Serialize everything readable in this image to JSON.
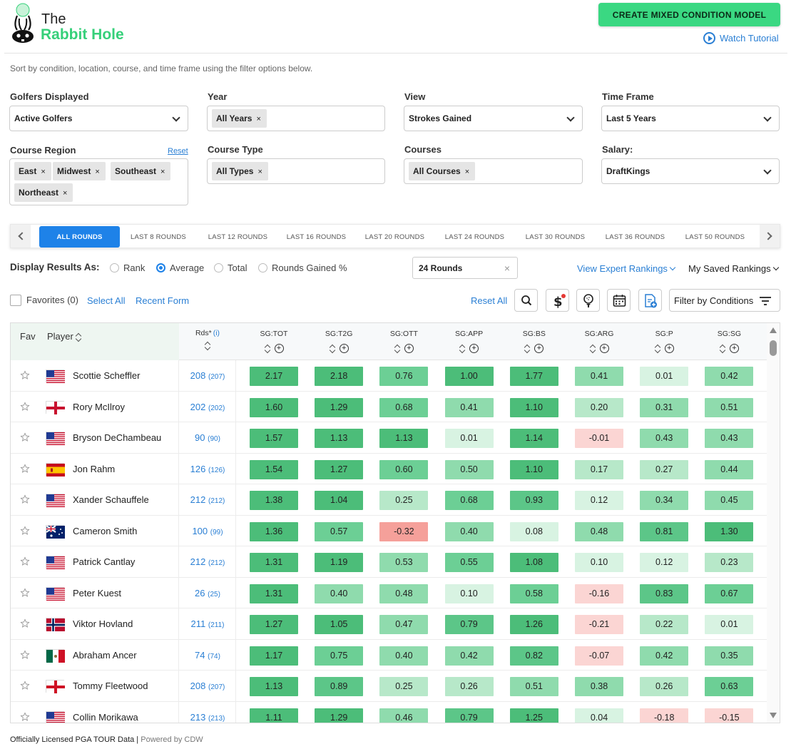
{
  "brand": {
    "the": "The",
    "name": "Rabbit Hole"
  },
  "header": {
    "cta_label": "CREATE MIXED CONDITION MODEL",
    "tutorial_label": "Watch Tutorial"
  },
  "subtitle": "Sort by condition, location, course, and time frame using the filter options below.",
  "filters": {
    "golfers": {
      "label": "Golfers Displayed",
      "value": "Active Golfers"
    },
    "year": {
      "label": "Year",
      "chips": [
        "All Years"
      ]
    },
    "view": {
      "label": "View",
      "value": "Strokes Gained"
    },
    "timeframe": {
      "label": "Time Frame",
      "value": "Last 5 Years"
    },
    "region": {
      "label": "Course Region",
      "reset": "Reset",
      "chips": [
        "East",
        "Midwest",
        "Southeast",
        "Northeast"
      ]
    },
    "course_type": {
      "label": "Course Type",
      "chips": [
        "All Types"
      ]
    },
    "courses": {
      "label": "Courses",
      "chips": [
        "All Courses"
      ]
    },
    "salary": {
      "label": "Salary:",
      "value": "DraftKings"
    }
  },
  "round_tabs": [
    "ALL ROUNDS",
    "LAST 8 ROUNDS",
    "LAST 12 ROUNDS",
    "LAST 16 ROUNDS",
    "LAST 20 ROUNDS",
    "LAST 24 ROUNDS",
    "LAST 30 ROUNDS",
    "LAST 36 ROUNDS",
    "LAST 50 ROUNDS"
  ],
  "display": {
    "label": "Display Results As:",
    "options": [
      "Rank",
      "Average",
      "Total",
      "Rounds Gained %"
    ],
    "selected": "Average",
    "rounds_value": "24 Rounds",
    "expert_link": "View Expert Rankings",
    "saved_link": "My Saved Rankings"
  },
  "toolbar": {
    "favorites": "Favorites (0)",
    "select_all": "Select All",
    "recent_form": "Recent Form",
    "reset_all": "Reset All",
    "filter_conditions": "Filter by Conditions"
  },
  "table": {
    "headers": {
      "fav": "Fav",
      "player": "Player",
      "rds": "Rds*",
      "rds_info": "(i)"
    },
    "stat_cols": [
      "SG:TOT",
      "SG:T2G",
      "SG:OTT",
      "SG:APP",
      "SG:BS",
      "SG:ARG",
      "SG:P",
      "SG:SG"
    ],
    "rows": [
      {
        "name": "Scottie Scheffler",
        "flag": "us",
        "rds": "208",
        "rds_sub": "(207)",
        "vals": [
          "2.17",
          "2.18",
          "0.76",
          "1.00",
          "1.77",
          "0.41",
          "0.01",
          "0.42"
        ]
      },
      {
        "name": "Rory McIlroy",
        "flag": "ni",
        "rds": "202",
        "rds_sub": "(202)",
        "vals": [
          "1.60",
          "1.29",
          "0.68",
          "0.41",
          "1.10",
          "0.20",
          "0.31",
          "0.51"
        ]
      },
      {
        "name": "Bryson DeChambeau",
        "flag": "us",
        "rds": "90",
        "rds_sub": "(90)",
        "vals": [
          "1.57",
          "1.13",
          "1.13",
          "0.01",
          "1.14",
          "-0.01",
          "0.43",
          "0.43"
        ]
      },
      {
        "name": "Jon Rahm",
        "flag": "es",
        "rds": "126",
        "rds_sub": "(126)",
        "vals": [
          "1.54",
          "1.27",
          "0.60",
          "0.50",
          "1.10",
          "0.17",
          "0.27",
          "0.44"
        ]
      },
      {
        "name": "Xander Schauffele",
        "flag": "us",
        "rds": "212",
        "rds_sub": "(212)",
        "vals": [
          "1.38",
          "1.04",
          "0.25",
          "0.68",
          "0.93",
          "0.12",
          "0.34",
          "0.45"
        ]
      },
      {
        "name": "Cameron Smith",
        "flag": "au",
        "rds": "100",
        "rds_sub": "(99)",
        "vals": [
          "1.36",
          "0.57",
          "-0.32",
          "0.40",
          "0.08",
          "0.48",
          "0.81",
          "1.30"
        ]
      },
      {
        "name": "Patrick Cantlay",
        "flag": "us",
        "rds": "212",
        "rds_sub": "(212)",
        "vals": [
          "1.31",
          "1.19",
          "0.53",
          "0.55",
          "1.08",
          "0.10",
          "0.12",
          "0.23"
        ]
      },
      {
        "name": "Peter Kuest",
        "flag": "us",
        "rds": "26",
        "rds_sub": "(25)",
        "vals": [
          "1.31",
          "0.40",
          "0.48",
          "0.10",
          "0.58",
          "-0.16",
          "0.83",
          "0.67"
        ]
      },
      {
        "name": "Viktor Hovland",
        "flag": "no",
        "rds": "211",
        "rds_sub": "(211)",
        "vals": [
          "1.27",
          "1.05",
          "0.47",
          "0.79",
          "1.26",
          "-0.21",
          "0.22",
          "0.01"
        ]
      },
      {
        "name": "Abraham Ancer",
        "flag": "mx",
        "rds": "74",
        "rds_sub": "(74)",
        "vals": [
          "1.17",
          "0.75",
          "0.40",
          "0.42",
          "0.82",
          "-0.07",
          "0.42",
          "0.35"
        ]
      },
      {
        "name": "Tommy Fleetwood",
        "flag": "en",
        "rds": "208",
        "rds_sub": "(207)",
        "vals": [
          "1.13",
          "0.89",
          "0.25",
          "0.26",
          "0.51",
          "0.38",
          "0.26",
          "0.63"
        ]
      },
      {
        "name": "Collin Morikawa",
        "flag": "us",
        "rds": "213",
        "rds_sub": "(213)",
        "vals": [
          "1.11",
          "1.29",
          "0.46",
          "0.79",
          "1.25",
          "0.04",
          "-0.18",
          "-0.15"
        ]
      }
    ]
  },
  "footer": {
    "licensed": "Officially Licensed PGA TOUR Data",
    "sep": " | ",
    "powered": "Powered by CDW"
  },
  "colors": {
    "accent_green": "#3ad882",
    "link_blue": "#2a7fd4",
    "active_tab": "#1e82e8"
  }
}
